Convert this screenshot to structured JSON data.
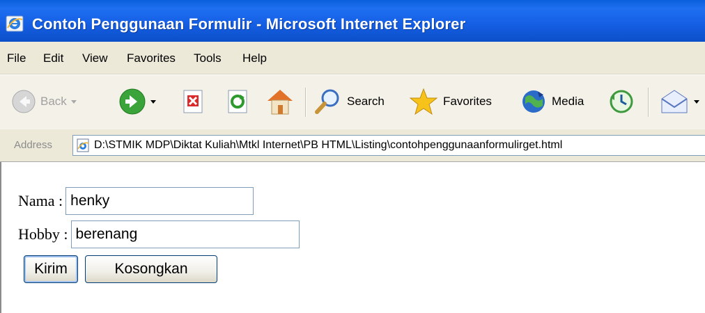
{
  "window": {
    "title": "Contoh Penggunaan Formulir - Microsoft Internet Explorer"
  },
  "menubar": {
    "items": [
      "File",
      "Edit",
      "View",
      "Favorites",
      "Tools",
      "Help"
    ]
  },
  "toolbar": {
    "back_label": "Back",
    "search_label": "Search",
    "favorites_label": "Favorites",
    "media_label": "Media",
    "icons": [
      "back-icon",
      "forward-icon",
      "stop-icon",
      "refresh-icon",
      "home-icon",
      "search-icon",
      "favorites-icon",
      "media-icon",
      "history-icon",
      "mail-icon"
    ]
  },
  "address": {
    "label": "Address",
    "url": "D:\\STMIK MDP\\Diktat Kuliah\\Mtkl Internet\\PB HTML\\Listing\\contohpenggunaanformulirget.html"
  },
  "form": {
    "nama_label": "Nama :",
    "nama_value": "henky",
    "hobby_label": "Hobby :",
    "hobby_value": "berenang",
    "submit_label": "Kirim",
    "reset_label": "Kosongkan"
  },
  "colors": {
    "titlebar": "#1660e6",
    "chrome": "#ece9d8",
    "input_border": "#7f9db9",
    "button_border": "#003c74"
  }
}
